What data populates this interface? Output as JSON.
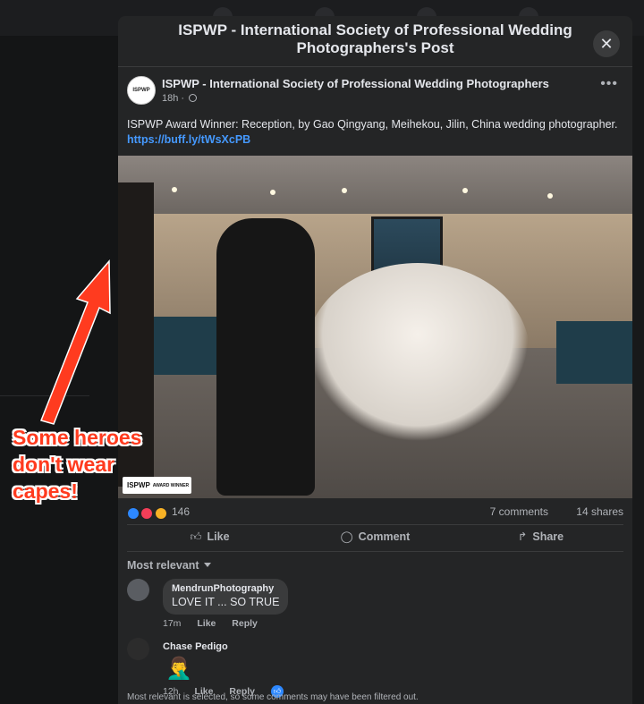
{
  "modal": {
    "title": "ISPWP - International Society of Professional Wedding Photographers's Post",
    "close_icon": "close-icon"
  },
  "post": {
    "page_name": "ISPWP - International Society of Professional Wedding Photographers",
    "time": "18h ·",
    "avatar_text": "ISPWP",
    "text": "ISPWP Award Winner: Reception, by Gao Qingyang, Meihekou, Jilin, China wedding photographer.",
    "link": "https://buff.ly/tWsXcPB",
    "badge": {
      "main": "ISPWP",
      "sub": "AWARD WINNER"
    }
  },
  "stats": {
    "reactions": "146",
    "comments": "7 comments",
    "shares": "14 shares"
  },
  "actions": {
    "like": "Like",
    "comment": "Comment",
    "share": "Share"
  },
  "filter": {
    "label": "Most relevant"
  },
  "comments": [
    {
      "author": "MendrunPhotography",
      "text": "LOVE IT ... SO TRUE",
      "time": "17m",
      "like": "Like",
      "reply": "Reply"
    },
    {
      "author": "Chase Pedigo",
      "text": "🤦‍♂️",
      "time": "12h",
      "like": "Like",
      "reply": "Reply"
    }
  ],
  "note": "Most relevant is selected, so some comments may have been filtered out.",
  "annotation": "Some heroes don't wear capes!",
  "colors": {
    "accent": "#4599ff",
    "annotation": "#ff3b1f",
    "modal_bg": "#242526"
  }
}
